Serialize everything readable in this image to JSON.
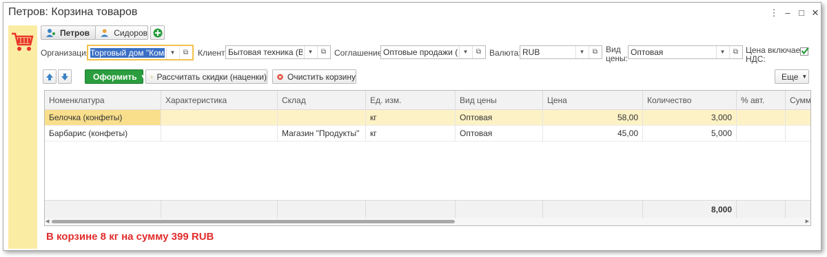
{
  "window": {
    "title": "Петров: Корзина товаров",
    "menu_icon": "more-vertical-icon",
    "minimize_icon": "minimize-icon",
    "maximize_icon": "maximize-icon",
    "close_icon": "close-icon"
  },
  "tabs": [
    {
      "label": "Петров",
      "active": true
    },
    {
      "label": "Сидоров",
      "active": false
    }
  ],
  "form": {
    "org_label": "Организация:",
    "org_value": "Торговый дом \"Компле",
    "client_label": "Клиент:",
    "client_value": "Бытовая техника (Влад",
    "agreement_label": "Соглашение:",
    "agreement_value": "Оптовые продажи (экс",
    "currency_label": "Валюта:",
    "currency_value": "RUB",
    "price_type_label_1": "Вид",
    "price_type_label_2": "цены:",
    "price_type_value": "Оптовая",
    "vat_label_1": "Цена включает",
    "vat_label_2": "НДС:",
    "vat_checked": true
  },
  "toolbar": {
    "submit_label": "Оформить",
    "calc_label": "Рассчитать скидки (наценки)",
    "clear_label": "Очистить корзину",
    "more_label": "Еще"
  },
  "table": {
    "columns": [
      "Номенклатура",
      "Характеристика",
      "Склад",
      "Ед. изм.",
      "Вид цены",
      "Цена",
      "Количество",
      "% авт.",
      "Сумма"
    ],
    "rows": [
      [
        "Белочка (конфеты)",
        "",
        "",
        "кг",
        "Оптовая",
        "58,00",
        "3,000",
        "",
        ""
      ],
      [
        "Барбарис (конфеты)",
        "",
        "Магазин \"Продукты\"",
        "кг",
        "Оптовая",
        "45,00",
        "5,000",
        "",
        ""
      ]
    ],
    "total_quantity": "8,000"
  },
  "summary": "В корзине 8 кг на сумму 399 RUB",
  "colors": {
    "accent_green": "#2a9d3e",
    "sidebar": "#fbeca3",
    "selected_row": "#fdf2c6",
    "summary_red": "#e12c2c"
  }
}
